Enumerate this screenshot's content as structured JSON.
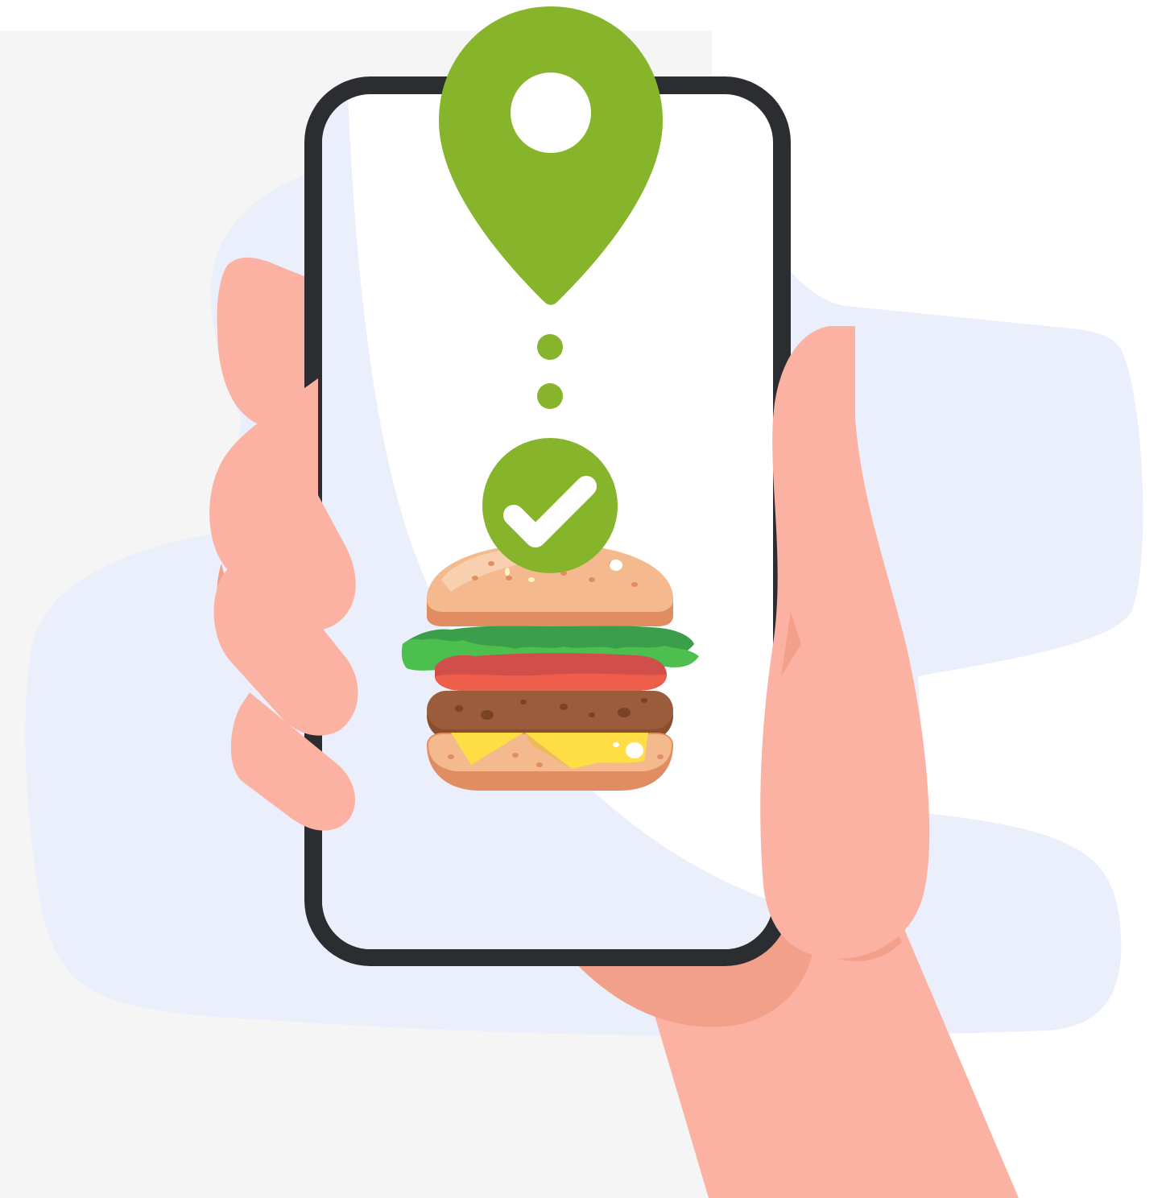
{
  "illustration": {
    "icons": [
      "location-pin-icon",
      "progress-dot-icon",
      "checkmark-icon",
      "burger-icon"
    ],
    "colors": {
      "background_panel": "#f5f5f5",
      "background_blob": "#ebeffb",
      "phone_frame": "#2c2d30",
      "phone_screen": "#ffffff",
      "accent_green": "#86b52c",
      "skin": "#fbb2a2",
      "skin_shadow": "#f3a08a",
      "bun": "#f4b98c",
      "bun_dark": "#e08d61",
      "lettuce": "#4cbf4f",
      "tomato": "#ef5d4b",
      "patty": "#9a5c3a",
      "cheese": "#ffdd44"
    }
  }
}
